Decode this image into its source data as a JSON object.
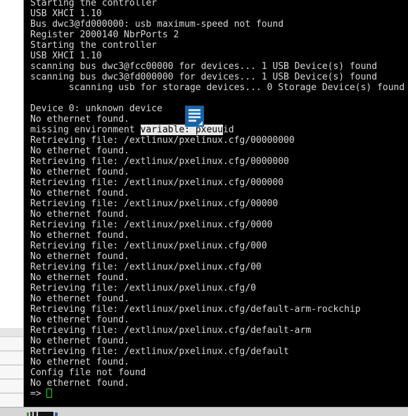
{
  "window": {
    "type": "serial-console-terminal",
    "background_color": "#000000",
    "text_color": "#d8d8d8",
    "cursor_color": "#18e018",
    "selection_background": "#e8e8e8",
    "selection_text_color": "#000000"
  },
  "terminal": {
    "lines": [
      "Starting the controller",
      "USB XHCI 1.10",
      "Bus dwc3@fd000000: usb maximum-speed not found",
      "Register 2000140 NbrPorts 2",
      "Starting the controller",
      "USB XHCI 1.10",
      "scanning bus dwc3@fcc00000 for devices... 1 USB Device(s) found",
      "scanning bus dwc3@fd000000 for devices... 1 USB Device(s) found",
      "       scanning usb for storage devices... 0 Storage Device(s) found",
      "",
      "Device 0: unknown device",
      "No ethernet found.",
      "__SELECTION_LINE__",
      "Retrieving file: /extlinux/pxelinux.cfg/00000000",
      "No ethernet found.",
      "Retrieving file: /extlinux/pxelinux.cfg/0000000",
      "No ethernet found.",
      "Retrieving file: /extlinux/pxelinux.cfg/000000",
      "No ethernet found.",
      "Retrieving file: /extlinux/pxelinux.cfg/00000",
      "No ethernet found.",
      "Retrieving file: /extlinux/pxelinux.cfg/0000",
      "No ethernet found.",
      "Retrieving file: /extlinux/pxelinux.cfg/000",
      "No ethernet found.",
      "Retrieving file: /extlinux/pxelinux.cfg/00",
      "No ethernet found.",
      "Retrieving file: /extlinux/pxelinux.cfg/0",
      "No ethernet found.",
      "Retrieving file: /extlinux/pxelinux.cfg/default-arm-rockchip",
      "No ethernet found.",
      "Retrieving file: /extlinux/pxelinux.cfg/default-arm",
      "No ethernet found.",
      "Retrieving file: /extlinux/pxelinux.cfg/default",
      "No ethernet found.",
      "Config file not found",
      "No ethernet found.",
      "__PROMPT_LINE__"
    ],
    "selection_line": {
      "prefix": "missing environment ",
      "selected": "variable: pxeuu",
      "suffix": "id"
    },
    "prompt": {
      "symbol": "=> ",
      "cursor": "block"
    }
  },
  "drag_icon": {
    "name": "document-icon",
    "color": "#1664a8",
    "line_color": "#cfe3f3"
  },
  "background_app": {
    "list_rows": [
      "",
      "",
      "",
      "",
      "",
      ""
    ]
  }
}
